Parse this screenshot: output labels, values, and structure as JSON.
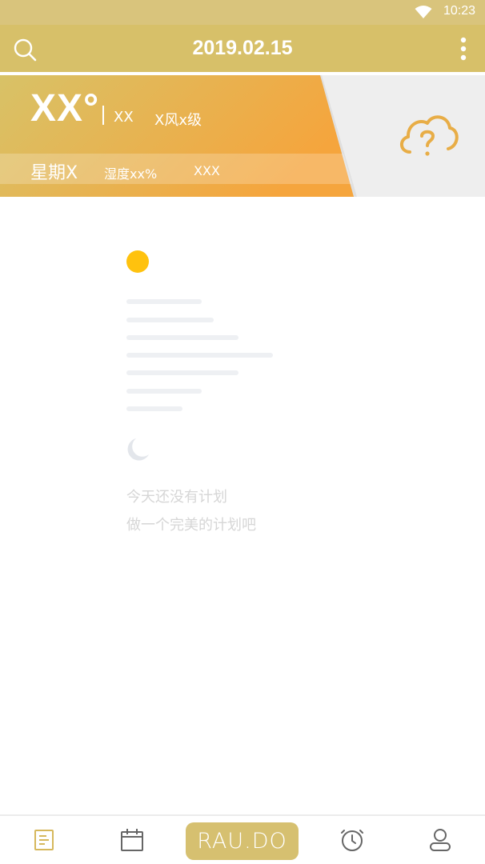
{
  "status_bar": {
    "time": "10:23",
    "wifi_icon": "wifi-icon"
  },
  "app_bar": {
    "title": "2019.02.15",
    "search_icon": "search-icon",
    "more_icon": "more-vertical-icon"
  },
  "weather": {
    "temperature": "XX°",
    "condition": "XX",
    "wind": "X风x级",
    "weekday": "星期X",
    "humidity": "湿度xx%",
    "air_quality": "XXX",
    "icon": "cloud-question-icon",
    "colors": {
      "primary": "#d7c069",
      "accent": "#f4a63e",
      "panel": "#eeeeee"
    }
  },
  "empty_state": {
    "sun_icon": "sun-icon",
    "moon_icon": "moon-icon",
    "message_line1": "今天还没有计划",
    "message_line2": "做一个完美的计划吧",
    "colors": {
      "sun": "#ffc20e",
      "moon": "#e3e6eb",
      "lines": "#eef0f3",
      "text": "#d6d6d6"
    }
  },
  "bottom_nav": {
    "items": [
      {
        "icon": "list-icon"
      },
      {
        "icon": "calendar-icon"
      },
      {
        "brand": "RAU.DO"
      },
      {
        "icon": "alarm-clock-icon"
      },
      {
        "icon": "user-icon"
      }
    ]
  }
}
